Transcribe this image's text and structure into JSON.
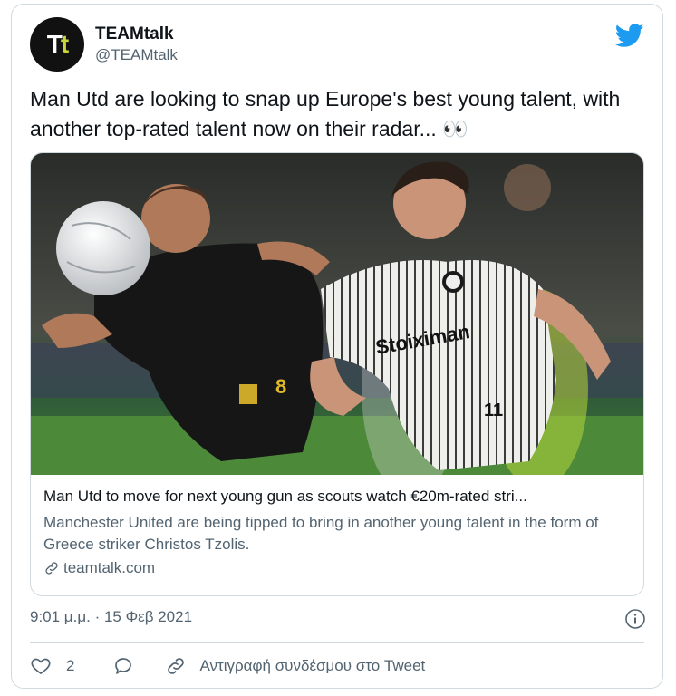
{
  "author": {
    "name": "TEAMtalk",
    "handle": "@TEAMtalk",
    "avatar_letters": [
      "T",
      "t"
    ]
  },
  "tweet_text": "Man Utd are looking to snap up Europe's best young talent, with another top-rated talent now on their radar... 👀",
  "card": {
    "title": "Man Utd to move for next young gun as scouts watch €20m-rated stri...",
    "description": "Manchester United are being tipped to bring in another young talent in the form of Greece striker Christos Tzolis.",
    "domain": "teamtalk.com",
    "image_shirt_text": "Stoiximan",
    "image_number": "11",
    "image_opponent_number": "8"
  },
  "timestamp": "9:01 μ.μ. · 15 Φεβ 2021",
  "actions": {
    "like_count": "2",
    "copy_link_label": "Αντιγραφή συνδέσμου στο Tweet"
  },
  "icons": {
    "logo": "twitter-bird-icon",
    "info": "info-icon",
    "like": "heart-icon",
    "reply": "reply-bubble-icon",
    "link": "link-icon"
  },
  "colors": {
    "twitter_blue": "#1d9bf0",
    "secondary_text": "#536471",
    "border": "#cfd9de"
  }
}
